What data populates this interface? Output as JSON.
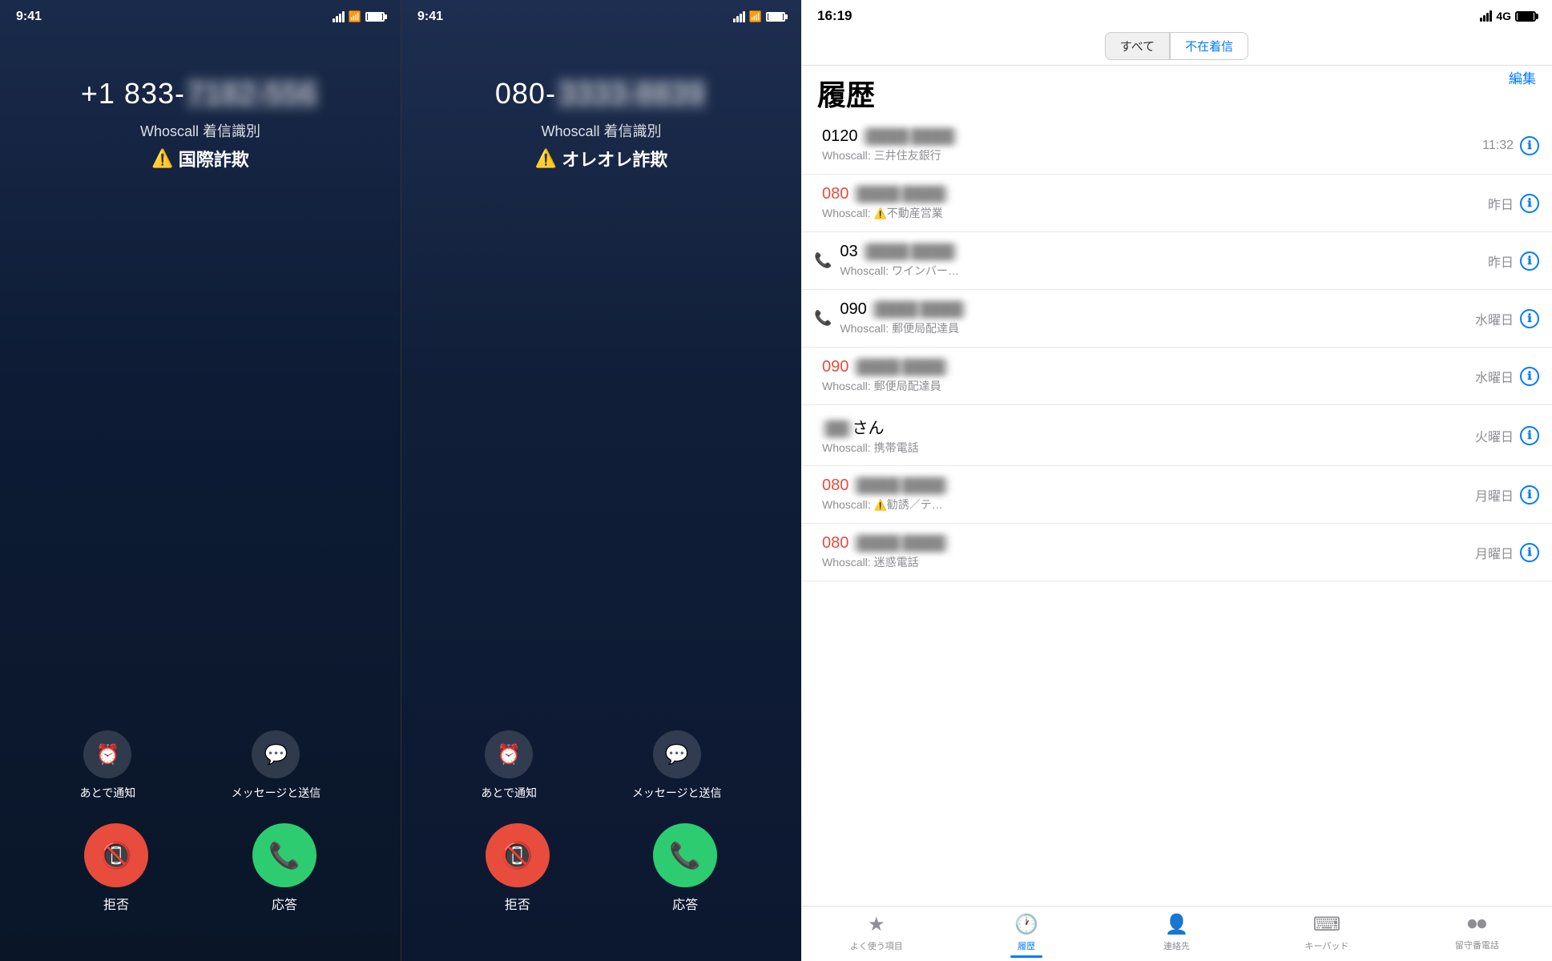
{
  "screen1": {
    "time": "9:41",
    "caller": "+1 833-",
    "caller_blurred": "7182-556",
    "whoscall_label": "Whoscall 着信識別",
    "fraud_label": "国際詐欺",
    "remind_label": "あとで通知",
    "message_label": "メッセージと送信",
    "decline_label": "拒否",
    "answer_label": "応答"
  },
  "screen2": {
    "time": "9:41",
    "caller": "080-",
    "caller_blurred": "3333-8839",
    "whoscall_label": "Whoscall 着信識別",
    "fraud_label": "オレオレ詐欺",
    "remind_label": "あとで通知",
    "message_label": "メッセージと送信",
    "decline_label": "拒否",
    "answer_label": "応答"
  },
  "panel": {
    "time": "16:19",
    "tabs": {
      "all": "すべて",
      "missed": "不在着信",
      "edit": "編集"
    },
    "title": "履歴",
    "calls": [
      {
        "number": "0120",
        "number_blurred": "████ ████",
        "type": "normal",
        "description": "Whoscall: 三井住友銀行",
        "time": "11:32",
        "icon": "phone"
      },
      {
        "number": "080",
        "number_blurred": "████ ████",
        "type": "red",
        "description": "Whoscall: ⚠️不動産営業",
        "time": "昨日",
        "icon": "phone"
      },
      {
        "number": "03",
        "number_blurred": "████ ████",
        "type": "normal",
        "description": "Whoscall: ワインバー…",
        "time": "昨日",
        "icon": "missed"
      },
      {
        "number": "090",
        "number_blurred": "████ ████",
        "type": "normal",
        "description": "Whoscall: 郵便局配達員",
        "time": "水曜日",
        "icon": "missed"
      },
      {
        "number": "090",
        "number_blurred": "████ ████",
        "type": "red",
        "description": "Whoscall: 郵便局配達員",
        "time": "水曜日",
        "icon": "phone"
      },
      {
        "number": "██さん",
        "number_blurred": "",
        "type": "normal",
        "description": "Whoscall: 携帯電話",
        "time": "火曜日",
        "icon": "phone"
      },
      {
        "number": "080",
        "number_blurred": "████ ████",
        "type": "red",
        "description": "Whoscall: ⚠️勧誘／テ…",
        "time": "月曜日",
        "icon": "phone"
      },
      {
        "number": "080",
        "number_blurred": "████ ████",
        "type": "red",
        "description": "Whoscall: 迷惑電話",
        "time": "月曜日",
        "icon": "phone"
      }
    ],
    "bottom_tabs": [
      {
        "icon": "★",
        "label": "よく使う項目",
        "active": false
      },
      {
        "icon": "🕐",
        "label": "履歴",
        "active": true
      },
      {
        "icon": "👤",
        "label": "連絡先",
        "active": false
      },
      {
        "icon": "⌨",
        "label": "キーパッド",
        "active": false
      },
      {
        "icon": "⏺",
        "label": "留守番電話",
        "active": false
      }
    ]
  }
}
